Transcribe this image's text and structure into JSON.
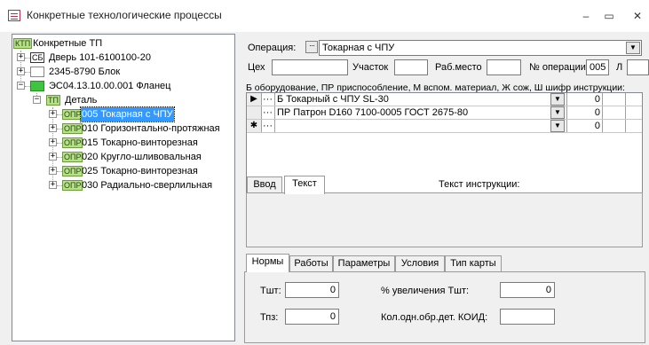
{
  "window": {
    "title": "Конкретные технологические процессы",
    "minimize": "‒",
    "maximize": "▭",
    "close": "✕"
  },
  "tree": {
    "root_tag": "КТП",
    "root_label": "Конкретные ТП",
    "items": [
      {
        "tag": "СБ",
        "label": "Дверь 101-6100100-20"
      },
      {
        "tag": "",
        "label": "2345-8790 Блок"
      },
      {
        "tag": "",
        "label": "ЭС04.13.10.00.001 Фланец"
      },
      {
        "tag": "ТП",
        "label": "Деталь"
      },
      {
        "tag": "ОПР",
        "label": "005 Токарная с ЧПУ"
      },
      {
        "tag": "ОПР",
        "label": "010 Горизонтально-протяжная"
      },
      {
        "tag": "ОПР",
        "label": "015 Токарно-винторезная"
      },
      {
        "tag": "ОПР",
        "label": "020 Кругло-шливовальная"
      },
      {
        "tag": "ОПР",
        "label": "025 Токарно-винторезная"
      },
      {
        "tag": "ОПР",
        "label": "030 Радиально-сверлильная"
      }
    ]
  },
  "operation": {
    "label": "Операция:",
    "value": "Токарная с ЧПУ",
    "cex_label": "Цех",
    "cex_value": "",
    "uchastok_label": "Участок",
    "uchastok_value": "",
    "rabmesto_label": "Раб.место",
    "rabmesto_value": "",
    "num_label": "№ операции",
    "num_value": "005",
    "l_label": "Л",
    "l_value": ""
  },
  "grid": {
    "legend": "Б оборудование, ПР приспособление, М вспом. материал, Ж сож, Ш шифр инструкции:",
    "rows": [
      {
        "marker": "▶",
        "value": "Б Токарный с ЧПУ SL-30",
        "num": "0"
      },
      {
        "marker": "",
        "value": "ПР Патрон D160 7100-0005 ГОСТ 2675-80",
        "num": "0"
      },
      {
        "marker": "✱",
        "value": "",
        "num": "0"
      }
    ]
  },
  "instruction": {
    "tabs": [
      "Ввод",
      "Текст"
    ],
    "title": "Текст инструкции:"
  },
  "norms": {
    "tabs": [
      "Нормы",
      "Работы",
      "Параметры",
      "Условия",
      "Тип карты"
    ],
    "tsht_label": "Тшт:",
    "tsht_value": "0",
    "tpz_label": "Тпз:",
    "tpz_value": "0",
    "uvel_label": "% увеличения Тшт:",
    "uvel_value": "0",
    "koid_label": "Кол.одн.обр.дет. КОИД:",
    "koid_value": ""
  }
}
